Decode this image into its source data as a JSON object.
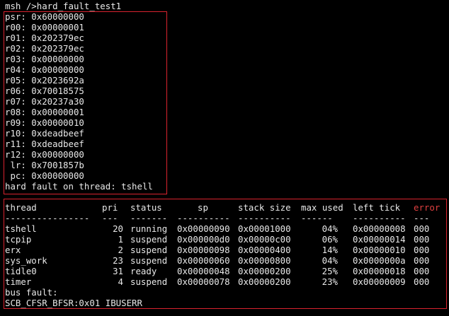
{
  "colors": {
    "background": "#000000",
    "text": "#e8e8e8",
    "highlight_box": "#d9232e",
    "error_header": "#e04040"
  },
  "command": "msh />hard_fault_test1",
  "registers": [
    "psr: 0x60000000",
    "r00: 0x00000001",
    "r01: 0x202379ec",
    "r02: 0x202379ec",
    "r03: 0x00000000",
    "r04: 0x00000000",
    "r05: 0x2023692a",
    "r06: 0x70018575",
    "r07: 0x20237a30",
    "r08: 0x00000001",
    "r09: 0x00000010",
    "r10: 0xdeadbeef",
    "r11: 0xdeadbeef",
    "r12: 0x00000000",
    " lr: 0x7001857b",
    " pc: 0x00000000"
  ],
  "fault_message": "hard fault on thread: tshell",
  "thread_table": {
    "headers": {
      "thread": "thread",
      "pri": "pri",
      "status": "status",
      "sp": "sp",
      "stack_size": "stack size",
      "max_used": "max used",
      "left_tick": "left tick",
      "error": "error"
    },
    "separators": {
      "thread": "----------------",
      "pri": "---",
      "status": "-------",
      "sp": "----------",
      "stack_size": "----------",
      "max_used": "------",
      "left_tick": "----------",
      "error": "---"
    },
    "rows": [
      {
        "thread": "tshell",
        "pri": "20",
        "status": "running",
        "sp": "0x00000090",
        "stack_size": "0x00001000",
        "max_used": "04%",
        "left_tick": "0x00000008",
        "error": "000"
      },
      {
        "thread": "tcpip",
        "pri": "1",
        "status": "suspend",
        "sp": "0x000000d0",
        "stack_size": "0x00000c00",
        "max_used": "06%",
        "left_tick": "0x00000014",
        "error": "000"
      },
      {
        "thread": "erx",
        "pri": "2",
        "status": "suspend",
        "sp": "0x00000098",
        "stack_size": "0x00000400",
        "max_used": "14%",
        "left_tick": "0x00000010",
        "error": "000"
      },
      {
        "thread": "sys_work",
        "pri": "23",
        "status": "suspend",
        "sp": "0x00000060",
        "stack_size": "0x00000800",
        "max_used": "04%",
        "left_tick": "0x0000000a",
        "error": "000"
      },
      {
        "thread": "tidle0",
        "pri": "31",
        "status": "ready",
        "sp": "0x00000048",
        "stack_size": "0x00000200",
        "max_used": "25%",
        "left_tick": "0x00000018",
        "error": "000"
      },
      {
        "thread": "timer",
        "pri": "4",
        "status": "suspend",
        "sp": "0x00000078",
        "stack_size": "0x00000200",
        "max_used": "23%",
        "left_tick": "0x00000009",
        "error": "000"
      }
    ]
  },
  "bus_fault_label": "bus fault:",
  "bus_fault_detail": "SCB_CFSR_BFSR:0x01 IBUSERR"
}
